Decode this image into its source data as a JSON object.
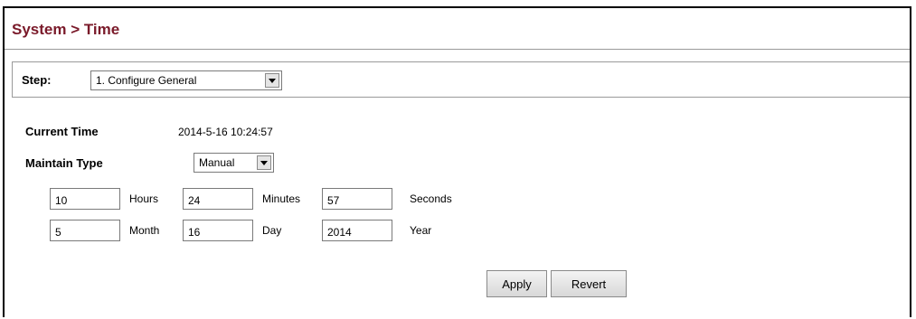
{
  "page": {
    "title": "System > Time"
  },
  "step": {
    "label": "Step:",
    "selected": "1. Configure General"
  },
  "current_time": {
    "label": "Current Time",
    "value": "2014-5-16 10:24:57"
  },
  "maintain_type": {
    "label": "Maintain Type",
    "selected": "Manual"
  },
  "time_fields": {
    "hours": {
      "value": "10",
      "label": "Hours"
    },
    "minutes": {
      "value": "24",
      "label": "Minutes"
    },
    "seconds": {
      "value": "57",
      "label": "Seconds"
    }
  },
  "date_fields": {
    "month": {
      "value": "5",
      "label": "Month"
    },
    "day": {
      "value": "16",
      "label": "Day"
    },
    "year": {
      "value": "2014",
      "label": "Year"
    }
  },
  "buttons": {
    "apply": "Apply",
    "revert": "Revert"
  },
  "colors": {
    "title": "#7a1a2a",
    "border": "#9a9a9a"
  }
}
